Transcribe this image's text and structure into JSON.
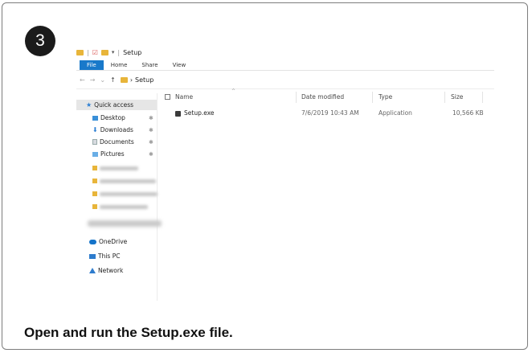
{
  "step": {
    "number": "3"
  },
  "caption": "Open and run the Setup.exe file.",
  "explorer": {
    "window_title": "Setup",
    "ribbon_tabs": [
      "File",
      "Home",
      "Share",
      "View"
    ],
    "breadcrumb": [
      "Setup"
    ],
    "sidebar": {
      "quick_access": "Quick access",
      "pinned": [
        "Desktop",
        "Downloads",
        "Documents",
        "Pictures"
      ],
      "locations": [
        "OneDrive",
        "This PC",
        "Network"
      ]
    },
    "columns": {
      "name": "Name",
      "date": "Date modified",
      "type": "Type",
      "size": "Size"
    },
    "files": [
      {
        "name": "Setup.exe",
        "date": "7/6/2019 10:43 AM",
        "type": "Application",
        "size": "10,566 KB"
      }
    ]
  },
  "colors": {
    "file_tab": "#1979ca",
    "folder": "#e8b53a",
    "badge": "#1b1b1b"
  }
}
